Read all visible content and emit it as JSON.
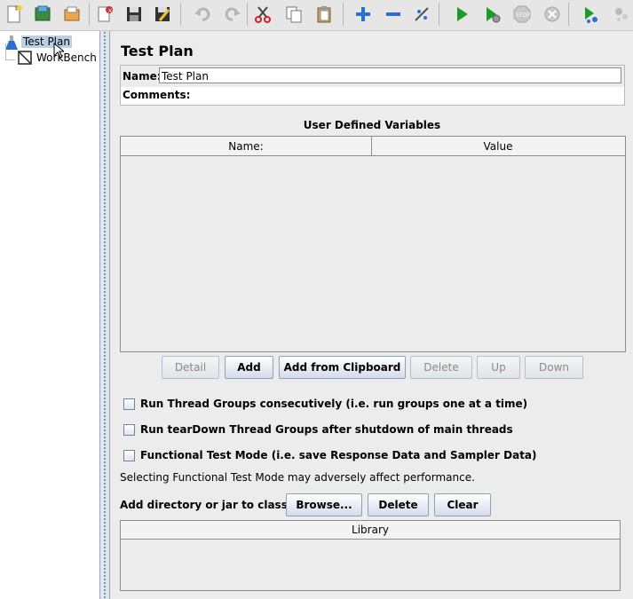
{
  "toolbar": {
    "buttons": [
      {
        "icon": "new-document-icon"
      },
      {
        "icon": "templates-icon"
      },
      {
        "icon": "open-icon"
      },
      {
        "icon": "close-icon"
      },
      {
        "icon": "save-icon"
      },
      {
        "icon": "save-as-icon"
      },
      {
        "icon": "undo-icon"
      },
      {
        "icon": "redo-icon"
      },
      {
        "icon": "cut-icon"
      },
      {
        "icon": "copy-icon"
      },
      {
        "icon": "paste-icon"
      },
      {
        "icon": "expand-icon"
      },
      {
        "icon": "collapse-icon"
      },
      {
        "icon": "toggle-icon"
      },
      {
        "icon": "start-icon"
      },
      {
        "icon": "start-no-pauses-icon"
      },
      {
        "icon": "stop-icon"
      },
      {
        "icon": "shutdown-icon"
      },
      {
        "icon": "remote-start-icon"
      },
      {
        "icon": "remote-stop-icon"
      }
    ]
  },
  "tree": {
    "items": [
      {
        "label": "Test Plan",
        "selected": true,
        "icon": "flask-icon"
      },
      {
        "label": "WorkBench",
        "selected": false,
        "icon": "workbench-icon"
      }
    ]
  },
  "panel": {
    "title": "Test Plan",
    "name_label": "Name:",
    "name_value": "Test Plan",
    "comments_label": "Comments:"
  },
  "variables": {
    "title": "User Defined Variables",
    "columns": [
      "Name:",
      "Value"
    ],
    "buttons": [
      {
        "label": "Detail",
        "enabled": false
      },
      {
        "label": "Add",
        "enabled": true
      },
      {
        "label": "Add from Clipboard",
        "enabled": true
      },
      {
        "label": "Delete",
        "enabled": false
      },
      {
        "label": "Up",
        "enabled": false
      },
      {
        "label": "Down",
        "enabled": false
      }
    ]
  },
  "options": [
    {
      "label": "Run Thread Groups consecutively (i.e. run groups one at a time)",
      "checked": false
    },
    {
      "label": "Run tearDown Thread Groups after shutdown of main threads",
      "checked": false
    },
    {
      "label": "Functional Test Mode (i.e. save Response Data and Sampler Data)",
      "checked": false
    }
  ],
  "functional_note": "Selecting Functional Test Mode may adversely affect performance.",
  "classpath": {
    "label": "Add directory or jar to classpath",
    "buttons": [
      "Browse...",
      "Delete",
      "Clear"
    ],
    "table_header": "Library"
  }
}
